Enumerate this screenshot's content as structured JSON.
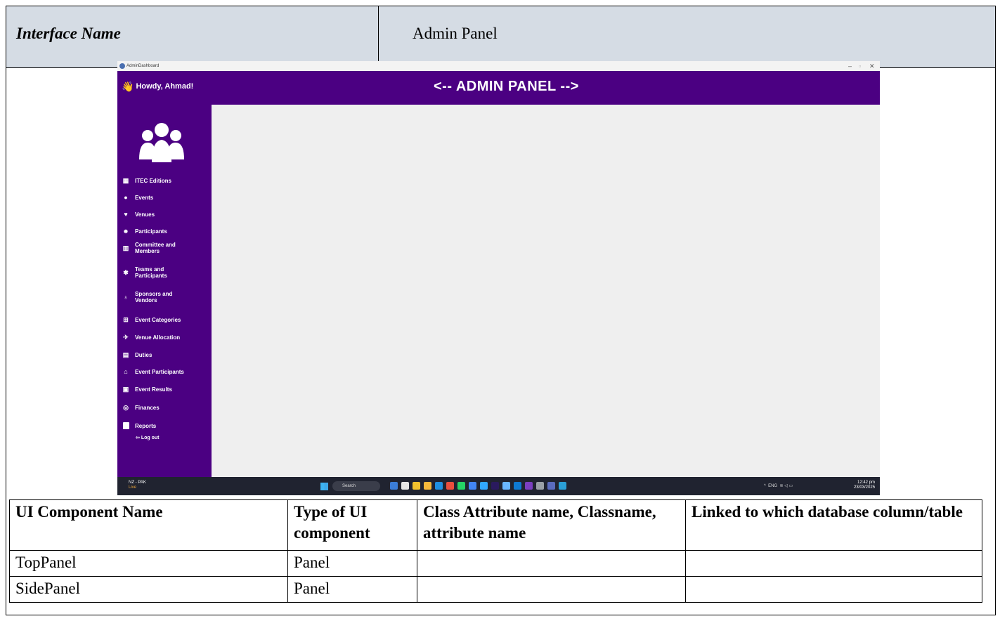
{
  "doc": {
    "interface_label": "Interface Name",
    "interface_value": "Admin Panel"
  },
  "window": {
    "title": "AdminDashboard",
    "controls": [
      "–",
      "▫",
      "✕"
    ]
  },
  "top_panel": {
    "greeting": "Howdy, Ahmad!",
    "title": "<-- ADMIN PANEL -->",
    "background": "#4b0082"
  },
  "side_panel": {
    "items": [
      {
        "label": "ITEC Editions",
        "icon": "calendar-icon"
      },
      {
        "label": "Events",
        "icon": "globe-icon"
      },
      {
        "label": "Venues",
        "icon": "map-pin-icon"
      },
      {
        "label": "Participants",
        "icon": "people-icon"
      },
      {
        "label": "Committee and Members",
        "icon": "committee-icon"
      },
      {
        "label": "Teams and Participants",
        "icon": "team-icon"
      },
      {
        "label": "Sponsors and Vendors",
        "icon": "money-bag-icon"
      },
      {
        "label": "Event Categories",
        "icon": "grid-icon"
      },
      {
        "label": "Venue Allocation",
        "icon": "pin-icon"
      },
      {
        "label": "Duties",
        "icon": "clipboard-icon"
      },
      {
        "label": "Event Participants",
        "icon": "building-icon"
      },
      {
        "label": "Event Results",
        "icon": "results-icon"
      },
      {
        "label": "Finances",
        "icon": "coins-icon"
      },
      {
        "label": "Reports",
        "icon": "document-icon"
      }
    ],
    "logout": "Log out"
  },
  "taskbar": {
    "weather": "NZ - PAK",
    "weather_sub": "Live",
    "search": "Search",
    "tray": "ENG",
    "time": "12:42 pm",
    "date": "23/03/2025"
  },
  "component_table": {
    "headers": [
      "UI Component Name",
      "Type of UI component",
      "Class Attribute name, Classname, attribute name",
      "Linked to which database column/table"
    ],
    "rows": [
      [
        "TopPanel",
        "Panel",
        "",
        ""
      ],
      [
        "SidePanel",
        "Panel",
        "",
        ""
      ]
    ]
  }
}
